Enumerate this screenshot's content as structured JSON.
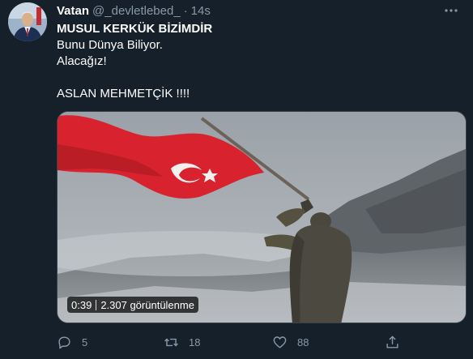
{
  "tweet": {
    "author_name": "Vatan",
    "author_handle": "@_devletlebed_",
    "separator": "·",
    "timestamp": "14s",
    "more_icon": "more-dots-icon",
    "text_lines": [
      "MUSUL KERKÜK BİZİMDİR",
      "Bunu Dünya Biliyor.",
      "Alacağız!",
      "ASLAN MEHMETÇİK !!!!"
    ],
    "video": {
      "duration": "0:39",
      "views": "2.307 görüntülenme"
    },
    "actions": {
      "reply_count": "5",
      "retweet_count": "18",
      "like_count": "88",
      "icons": [
        "reply-icon",
        "retweet-icon",
        "like-icon",
        "share-icon"
      ]
    }
  },
  "colors": {
    "background": "#15202b",
    "text": "#ffffff",
    "secondary": "#8899a6",
    "flag_red": "#d8232e",
    "border": "#38444d"
  }
}
